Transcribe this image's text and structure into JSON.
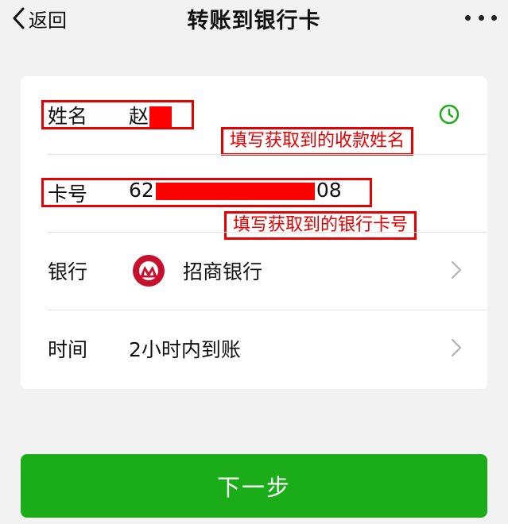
{
  "navbar": {
    "back_label": "返回",
    "title": "转账到银行卡"
  },
  "form": {
    "name": {
      "label": "姓名",
      "value_visible": "赵",
      "annotation": "填写获取到的收款姓名"
    },
    "card": {
      "label": "卡号",
      "prefix": "62",
      "suffix": "08",
      "annotation": "填写获取到的银行卡号"
    },
    "bank": {
      "label": "银行",
      "value": "招商银行",
      "logo_icon": "cmb-bank-logo-icon"
    },
    "time": {
      "label": "时间",
      "value": "2小时内到账"
    }
  },
  "primary_button": {
    "label": "下一步"
  },
  "colors": {
    "accent_green": "#1aad19",
    "annotation_red": "#e60000",
    "redaction_red": "#ff0000",
    "bank_logo_red": "#c8102e"
  }
}
